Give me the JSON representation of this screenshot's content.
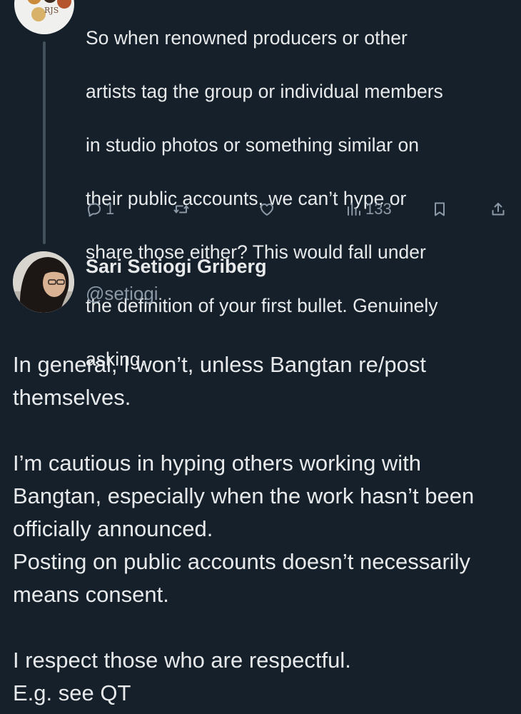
{
  "parent_tweet": {
    "text_lines": [
      "So when renowned producers or other",
      "artists tag the group or individual members",
      "in studio photos or something similar on",
      "their public accounts, we can’t hype or",
      "share those either?  This would fall under",
      "the definition of your first bullet.  Genuinely",
      "asking."
    ],
    "avatar_text": "RJS",
    "actions": {
      "reply_count": "1",
      "views_count": "133"
    }
  },
  "reply_tweet": {
    "author_name": "Sari Setiogi Griberg",
    "author_handle": "@setiogi",
    "paragraphs": [
      [
        "In general, I won’t, unless Bangtan re/post",
        "themselves."
      ],
      [
        "I’m cautious in hyping others working with",
        "Bangtan, especially when the work hasn’t been",
        "officially announced.",
        "Posting on public accounts doesn’t necessarily",
        "means consent."
      ],
      [
        "I respect those who are respectful.",
        "E.g. see QT"
      ]
    ]
  },
  "icons": {
    "reply": "comment-icon",
    "retweet": "retweet-icon",
    "like": "heart-icon",
    "views": "analytics-icon",
    "bookmark": "bookmark-icon",
    "share": "share-icon"
  },
  "colors": {
    "background": "#15202b",
    "text": "#e7e9ea",
    "muted": "#8b98a5",
    "thread_line": "#42505c"
  }
}
